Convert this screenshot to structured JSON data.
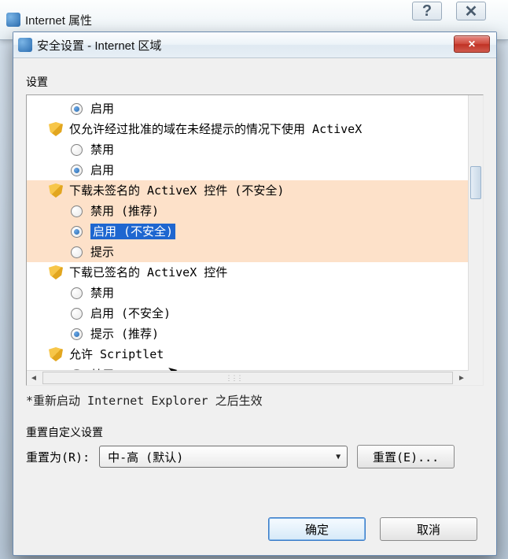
{
  "backWindow": {
    "title": "Internet 属性"
  },
  "dialog": {
    "title": "安全设置 - Internet 区域"
  },
  "sections": {
    "settingsLabel": "设置",
    "noteLabel": "*重新启动 Internet Explorer 之后生效",
    "customResetHeader": "重置自定义设置",
    "resetToLabel": "重置为(R):",
    "resetButtonLabel": "重置(E)...",
    "okLabel": "确定",
    "cancelLabel": "取消"
  },
  "resetLevel": {
    "selected": "中-高 (默认)"
  },
  "tree": {
    "topOption": {
      "label": "启用",
      "checked": true
    },
    "groupA": {
      "header": "仅允许经过批准的域在未经提示的情况下使用 ActiveX",
      "opts": [
        {
          "label": "禁用",
          "checked": false
        },
        {
          "label": "启用",
          "checked": true
        }
      ]
    },
    "groupB": {
      "header": "下载未签名的 ActiveX 控件 (不安全)",
      "opts": [
        {
          "label": "禁用 (推荐)",
          "checked": false
        },
        {
          "label": "启用 (不安全)",
          "checked": true
        },
        {
          "label": "提示",
          "checked": false
        }
      ]
    },
    "groupC": {
      "header": "下载已签名的 ActiveX 控件",
      "opts": [
        {
          "label": "禁用",
          "checked": false
        },
        {
          "label": "启用 (不安全)",
          "checked": false
        },
        {
          "label": "提示 (推荐)",
          "checked": true
        }
      ]
    },
    "groupD": {
      "header": "允许 Scriptlet",
      "opts": [
        {
          "label": "禁用",
          "checked": true
        }
      ]
    }
  }
}
